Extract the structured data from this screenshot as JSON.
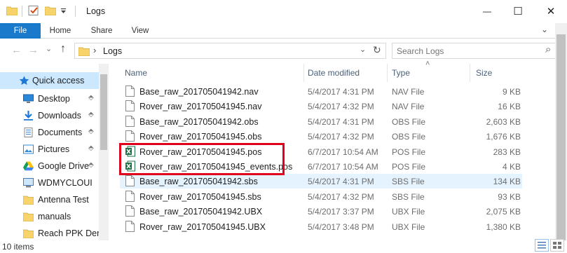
{
  "window": {
    "title": "Logs",
    "minimize_glyph": "—",
    "maximize_glyph": "☐",
    "close_glyph": "✕"
  },
  "ribbon": {
    "tabs": [
      "File",
      "Home",
      "Share",
      "View"
    ],
    "expand_glyph": "⌄",
    "help_glyph": "?"
  },
  "toolbar": {
    "back_glyph": "←",
    "forward_glyph": "→",
    "recent_glyph": "⌄",
    "up_glyph": "↑"
  },
  "address": {
    "separator": "›",
    "current": "Logs",
    "dropdown_glyph": "⌄",
    "refresh_glyph": "↻"
  },
  "search": {
    "placeholder": "Search Logs",
    "icon_glyph": "⌕"
  },
  "nav": {
    "items": [
      {
        "label": "Quick access",
        "icon": "star-icon",
        "pinned": false,
        "selected": true
      },
      {
        "label": "Desktop",
        "icon": "desktop-icon",
        "pinned": true
      },
      {
        "label": "Downloads",
        "icon": "download-icon",
        "pinned": true
      },
      {
        "label": "Documents",
        "icon": "documents-icon",
        "pinned": true
      },
      {
        "label": "Pictures",
        "icon": "pictures-icon",
        "pinned": true
      },
      {
        "label": "Google Drive",
        "icon": "google-drive-icon",
        "pinned": true
      },
      {
        "label": "WDMYCLOUI",
        "icon": "computer-icon",
        "pinned": false
      },
      {
        "label": "Antenna Test",
        "icon": "folder-icon",
        "pinned": false
      },
      {
        "label": "manuals",
        "icon": "folder-icon",
        "pinned": false
      },
      {
        "label": "Reach PPK Demo",
        "icon": "folder-icon",
        "pinned": false
      }
    ],
    "pin_glyph": "⬘"
  },
  "columns": {
    "name": "Name",
    "date": "Date modified",
    "type": "Type",
    "size": "Size",
    "sort_glyph": "˄"
  },
  "files": [
    {
      "name": "Base_raw_201705041942.nav",
      "date": "5/4/2017 4:31 PM",
      "type": "NAV File",
      "size": "9 KB",
      "icon": "file-icon"
    },
    {
      "name": "Rover_raw_201705041945.nav",
      "date": "5/4/2017 4:32 PM",
      "type": "NAV File",
      "size": "16 KB",
      "icon": "file-icon"
    },
    {
      "name": "Base_raw_201705041942.obs",
      "date": "5/4/2017 4:31 PM",
      "type": "OBS File",
      "size": "2,603 KB",
      "icon": "file-icon"
    },
    {
      "name": "Rover_raw_201705041945.obs",
      "date": "5/4/2017 4:32 PM",
      "type": "OBS File",
      "size": "1,676 KB",
      "icon": "file-icon"
    },
    {
      "name": "Rover_raw_201705041945.pos",
      "date": "6/7/2017 10:54 AM",
      "type": "POS File",
      "size": "283 KB",
      "icon": "excel-icon"
    },
    {
      "name": "Rover_raw_201705041945_events.pos",
      "date": "6/7/2017 10:54 AM",
      "type": "POS File",
      "size": "4 KB",
      "icon": "excel-icon"
    },
    {
      "name": "Base_raw_201705041942.sbs",
      "date": "5/4/2017 4:31 PM",
      "type": "SBS File",
      "size": "134 KB",
      "icon": "file-icon",
      "selected": true
    },
    {
      "name": "Rover_raw_201705041945.sbs",
      "date": "5/4/2017 4:32 PM",
      "type": "SBS File",
      "size": "93 KB",
      "icon": "file-icon"
    },
    {
      "name": "Base_raw_201705041942.UBX",
      "date": "5/4/2017 3:37 PM",
      "type": "UBX File",
      "size": "2,075 KB",
      "icon": "file-icon"
    },
    {
      "name": "Rover_raw_201705041945.UBX",
      "date": "5/4/2017 3:48 PM",
      "type": "UBX File",
      "size": "1,380 KB",
      "icon": "file-icon"
    }
  ],
  "status": {
    "items_text": "10 items"
  },
  "colors": {
    "file_tab": "#1979ca",
    "highlight_border": "#e0001b",
    "selected_row": "#e5f3ff",
    "nav_selected": "#cce8ff",
    "excel_green": "#1d7044",
    "folder_yellow": "#f6d36b"
  }
}
